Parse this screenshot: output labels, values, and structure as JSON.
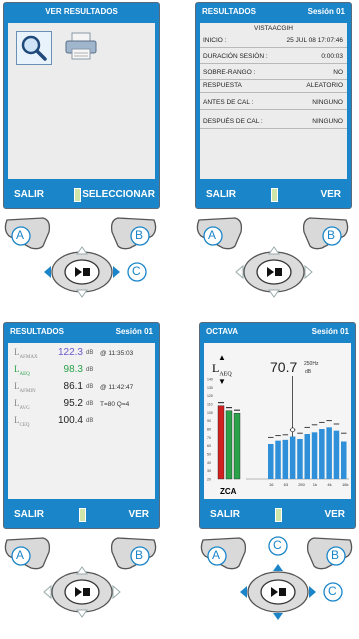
{
  "colors": {
    "blue": "#1a86c9",
    "green": "#2aa24a",
    "red": "#d02020",
    "purple": "#6a5acd"
  },
  "panel1": {
    "title": "VER RESULTADOS",
    "softkey_left": "SALIR",
    "softkey_right": "SELECCIONAR",
    "icons": [
      "magnifier-icon",
      "printer-icon"
    ],
    "button_a": "A",
    "button_b": "B",
    "button_c": "C"
  },
  "panel2": {
    "title": "RESULTADOS",
    "session": "Sesión 01",
    "file_name": "VISTAACGIH",
    "rows": [
      {
        "key": "INICIO :",
        "value": "25 JUL 08  17:07:46"
      },
      {
        "key": "DURACIÓN SESIÓN :",
        "value": "0:00:03"
      },
      {
        "key": "SOBRE-RANGO :",
        "value": "NO"
      },
      {
        "key": "RESPUESTA",
        "value": "ALEATORIO"
      },
      {
        "key": "ANTES DE CAL :",
        "value": "NINGUNO"
      },
      {
        "key": "DESPUÉS DE CAL :",
        "value": "NINGUNO"
      }
    ],
    "softkey_left": "SALIR",
    "softkey_right": "VER",
    "button_a": "A",
    "button_b": "B",
    "button_c": "C"
  },
  "panel3": {
    "title": "RESULTADOS",
    "session": "Sesión 01",
    "rows": [
      {
        "label": "L",
        "sub": "AFMAX",
        "value": "122.3",
        "unit": "dB",
        "extra": "@ 11:35:03",
        "color": "#6a5acd"
      },
      {
        "label": "L",
        "sub": "AEQ",
        "value": "98.3",
        "unit": "dB",
        "extra": "",
        "color": "#2aa24a"
      },
      {
        "label": "L",
        "sub": "AFMIN",
        "value": "86.1",
        "unit": "dB",
        "extra": "@ 11:42:47",
        "color": "#222222"
      },
      {
        "label": "L",
        "sub": "AVG",
        "value": "95.2",
        "unit": "dB",
        "extra": "T=80  Q=4",
        "color": "#222222"
      },
      {
        "label": "L",
        "sub": "CEQ",
        "value": "100.4",
        "unit": "dB",
        "extra": "",
        "color": "#222222"
      }
    ],
    "softkey_left": "SALIR",
    "softkey_right": "VER",
    "button_a": "A",
    "button_b": "B"
  },
  "panel4": {
    "title": "OCTAVA",
    "session": "Sesión 01",
    "metric_label": "L",
    "metric_sub": "AEQ",
    "value": "70.7",
    "value_unit": "dB",
    "value_freq": "250Hz",
    "zca_label": "ZCA",
    "softkey_left": "SALIR",
    "softkey_right": "VER",
    "button_a": "A",
    "button_b": "B",
    "button_c_top": "C",
    "button_c_right": "C",
    "y_ticks": [
      "140",
      "130",
      "120",
      "110",
      "100",
      "90",
      "80",
      "70",
      "60",
      "50",
      "40",
      "30",
      "20"
    ],
    "x_ticks": [
      "16",
      "63",
      "250",
      "1k",
      "4k",
      "16k"
    ]
  },
  "chart_data": {
    "type": "bar",
    "title": "OCTAVA",
    "ylim": [
      20,
      140
    ],
    "overall_bars": [
      {
        "name": "Z",
        "value": 108,
        "color": "#d02020"
      },
      {
        "name": "C",
        "value": 102,
        "color": "#2aa24a"
      },
      {
        "name": "A",
        "value": 99,
        "color": "#2aa24a"
      }
    ],
    "octave_values": [
      62,
      66,
      67,
      71,
      68,
      74,
      76,
      80,
      82,
      78,
      65
    ],
    "octave_peaks": [
      70,
      72,
      73,
      79,
      75,
      82,
      85,
      88,
      90,
      86,
      75
    ]
  }
}
